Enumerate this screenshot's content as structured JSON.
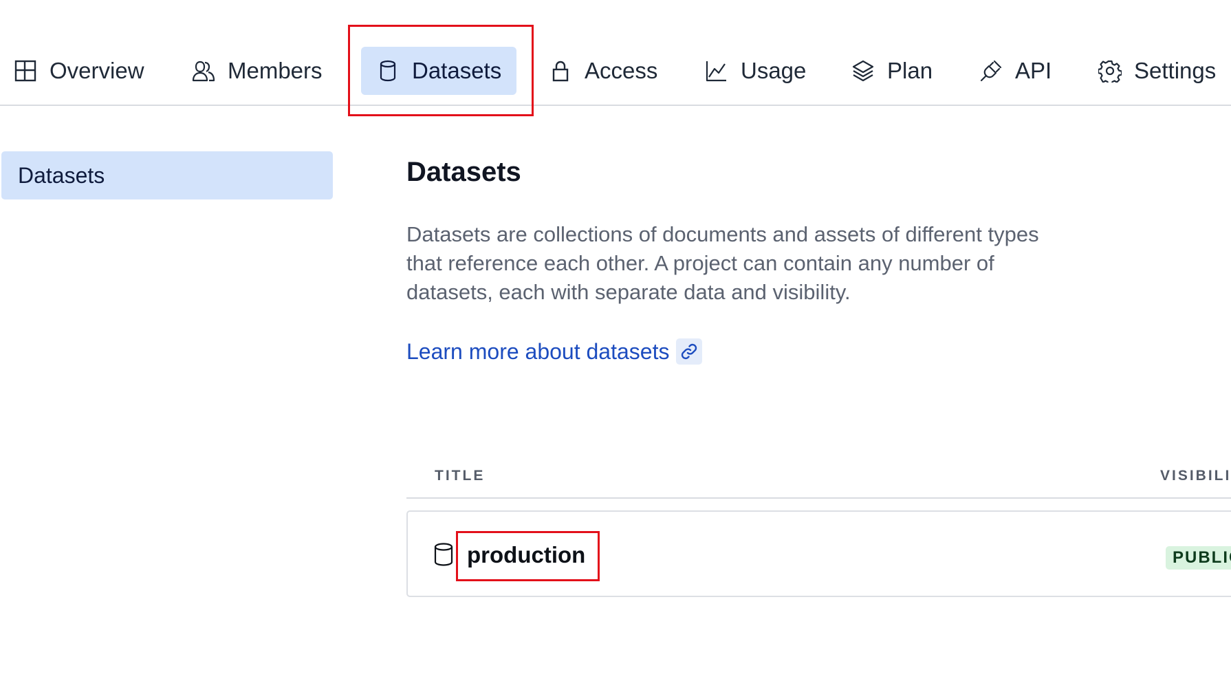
{
  "nav": {
    "tabs": [
      {
        "label": "Overview",
        "icon": "layout-icon"
      },
      {
        "label": "Members",
        "icon": "users-icon"
      },
      {
        "label": "Datasets",
        "icon": "database-icon",
        "active": true
      },
      {
        "label": "Access",
        "icon": "lock-icon"
      },
      {
        "label": "Usage",
        "icon": "chart-line-icon"
      },
      {
        "label": "Plan",
        "icon": "layers-icon"
      },
      {
        "label": "API",
        "icon": "plug-icon"
      },
      {
        "label": "Settings",
        "icon": "gear-icon"
      }
    ]
  },
  "sidebar": {
    "items": [
      {
        "label": "Datasets",
        "active": true
      }
    ]
  },
  "main": {
    "title": "Datasets",
    "description": "Datasets are collections of documents and assets of different types that reference each other. A project can contain any number of datasets, each with separate data and visibility.",
    "learn_more": "Learn more about datasets",
    "table": {
      "columns": [
        "TITLE",
        "VISIBILIT"
      ],
      "rows": [
        {
          "title": "production",
          "visibility": "PUBLIC"
        }
      ]
    }
  },
  "colors": {
    "accent_bg": "#d3e3fb",
    "link": "#1c4cbf",
    "highlight": "#e3101a",
    "badge_bg": "#d9f3df"
  }
}
